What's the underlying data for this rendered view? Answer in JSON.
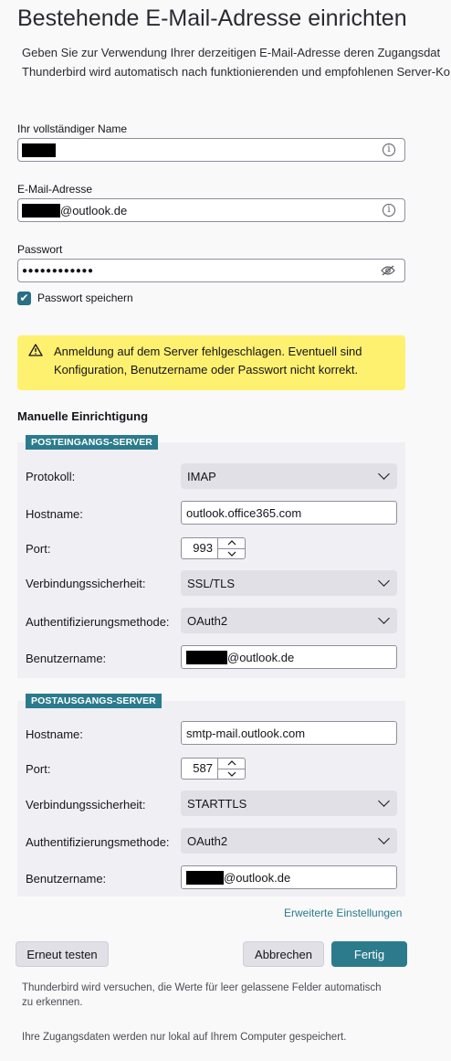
{
  "header": {
    "title": "Bestehende E-Mail-Adresse einrichten",
    "intro_line1": "Geben Sie zur Verwendung Ihrer derzeitigen E-Mail-Adresse deren Zugangsdat",
    "intro_line2": "Thunderbird wird automatisch nach funktionierenden und empfohlenen Server-Ko"
  },
  "form": {
    "name_label": "Ihr vollständiger Name",
    "email_label": "E-Mail-Adresse",
    "email_suffix": "@outlook.de",
    "password_label": "Passwort",
    "password_value": "●●●●●●●●●●●●",
    "remember_label": "Passwort speichern",
    "remember_checked": true
  },
  "alert": {
    "line1": "Anmeldung auf dem Server fehlgeschlagen. Eventuell sind",
    "line2": "Konfiguration, Benutzername oder Passwort nicht korrekt."
  },
  "manual": {
    "heading": "Manuelle Einrichtigung",
    "incoming": {
      "badge": "POSTEINGANGS-SERVER",
      "protocol_label": "Protokoll:",
      "protocol_value": "IMAP",
      "hostname_label": "Hostname:",
      "hostname_value": "outlook.office365.com",
      "port_label": "Port:",
      "port_value": "993",
      "security_label": "Verbindungssicherheit:",
      "security_value": "SSL/TLS",
      "auth_label": "Authentifizierungsmethode:",
      "auth_value": "OAuth2",
      "username_label": "Benutzername:",
      "username_suffix": "@outlook.de"
    },
    "outgoing": {
      "badge": "POSTAUSGANGS-SERVER",
      "hostname_label": "Hostname:",
      "hostname_value": "smtp-mail.outlook.com",
      "port_label": "Port:",
      "port_value": "587",
      "security_label": "Verbindungssicherheit:",
      "security_value": "STARTTLS",
      "auth_label": "Authentifizierungsmethode:",
      "auth_value": "OAuth2",
      "username_label": "Benutzername:",
      "username_suffix": "@outlook.de"
    },
    "advanced_link": "Erweiterte Einstellungen"
  },
  "buttons": {
    "retest": "Erneut testen",
    "cancel": "Abbrechen",
    "done": "Fertig"
  },
  "footer": {
    "note1_line1": "Thunderbird wird versuchen, die Werte für leer gelassene Felder automatisch",
    "note1_line2": "zu erkennen.",
    "note2": "Ihre Zugangsdaten werden nur lokal auf Ihrem Computer gespeichert."
  },
  "colors": {
    "accent": "#2b7b8c",
    "alert_bg": "#fff170",
    "panel_bg": "#f0f0f4"
  }
}
